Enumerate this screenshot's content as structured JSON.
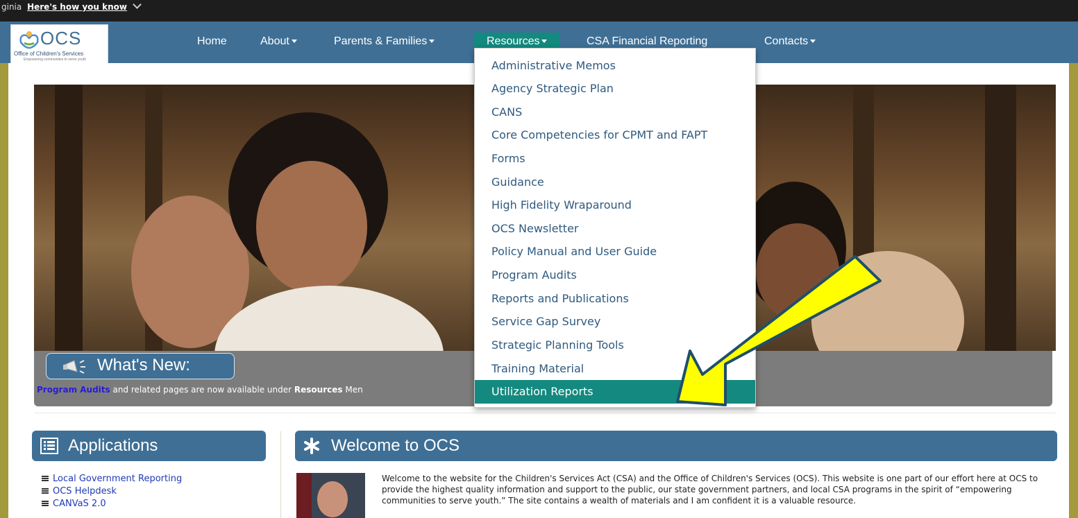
{
  "topbar": {
    "gov_text": "ginia",
    "how_link": "Here's how you know"
  },
  "logo": {
    "name": "OCS",
    "subtitle": "Office of Children's Services",
    "tagline": "Empowering communities to serve youth"
  },
  "nav": {
    "home": "Home",
    "about": "About",
    "parents": "Parents & Families",
    "resources": "Resources",
    "csa": "CSA Financial Reporting",
    "contacts": "Contacts"
  },
  "resources_menu": [
    "Administrative Memos",
    "Agency Strategic Plan",
    "CANS",
    "Core Competencies for CPMT and FAPT",
    "Forms",
    "Guidance",
    "High Fidelity Wraparound",
    "OCS Newsletter",
    "Policy Manual and User Guide",
    "Program Audits",
    "Reports and Publications",
    "Service Gap Survey",
    "Strategic Planning Tools",
    "Training Material",
    "Utilization Reports"
  ],
  "whats_new": {
    "title": "What's New:",
    "link": "Program Audits",
    "text_mid": " and related pages are now available under ",
    "bold": "Resources",
    "text_end": " Men"
  },
  "applications": {
    "title": "Applications",
    "items": [
      "Local Government Reporting",
      "OCS Helpdesk",
      "CANVaS 2.0"
    ]
  },
  "welcome": {
    "title": "Welcome to OCS",
    "body": "Welcome to the website for the Children's Services Act (CSA) and the Office of Children's Services (OCS). This website is one part of our effort here at OCS to provide the highest quality information and support to the public, our state government partners, and local CSA programs in the spirit of “empowering communities to serve youth.” The site contains a wealth of materials and I am confident it is a valuable resource."
  },
  "colors": {
    "nav_bg": "#3f6f95",
    "active": "#14897f",
    "highlight_arrow": "#ffff00",
    "page_border": "#a39a3d"
  }
}
